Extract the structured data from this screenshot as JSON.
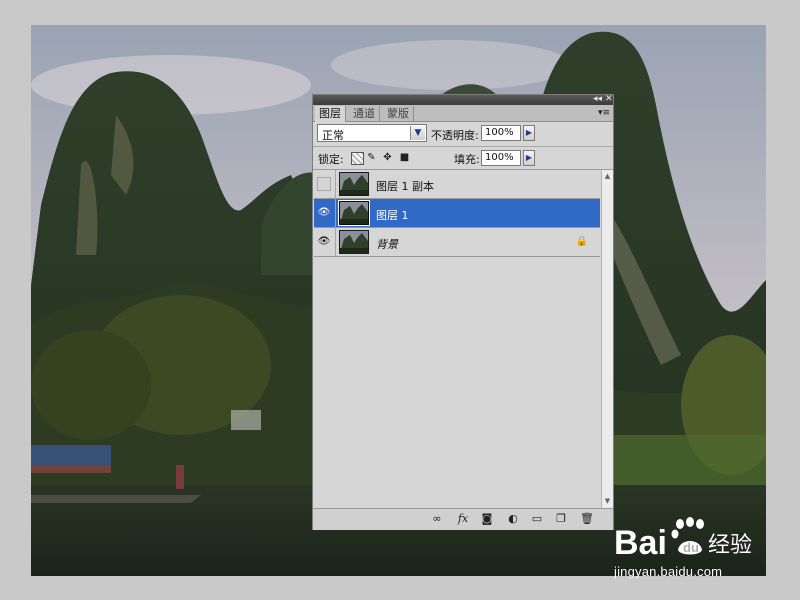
{
  "panel": {
    "tabs": [
      "图层",
      "通道",
      "蒙版"
    ],
    "active_tab": "图层",
    "blend_mode": "正常",
    "opacity_label": "不透明度:",
    "opacity_value": "100%",
    "lock_label": "锁定:",
    "fill_label": "填充:",
    "fill_value": "100%",
    "layers": [
      {
        "name": "图层 1 副本",
        "visible": false,
        "selected": false,
        "locked": false
      },
      {
        "name": "图层 1",
        "visible": true,
        "selected": true,
        "locked": false
      },
      {
        "name": "背景",
        "visible": true,
        "selected": false,
        "locked": true
      }
    ],
    "bottom_icons": [
      "link-icon",
      "fx-icon",
      "mask-icon",
      "adjustment-icon",
      "folder-icon",
      "new-layer-icon",
      "trash-icon"
    ],
    "fx_label": "fx"
  },
  "colors": {
    "selection": "#3169c6",
    "panel_bg": "#d6d6d6"
  },
  "watermark": {
    "brand": "Bai",
    "brand_suffix": "经验",
    "url": "jingyan.baidu.com"
  }
}
